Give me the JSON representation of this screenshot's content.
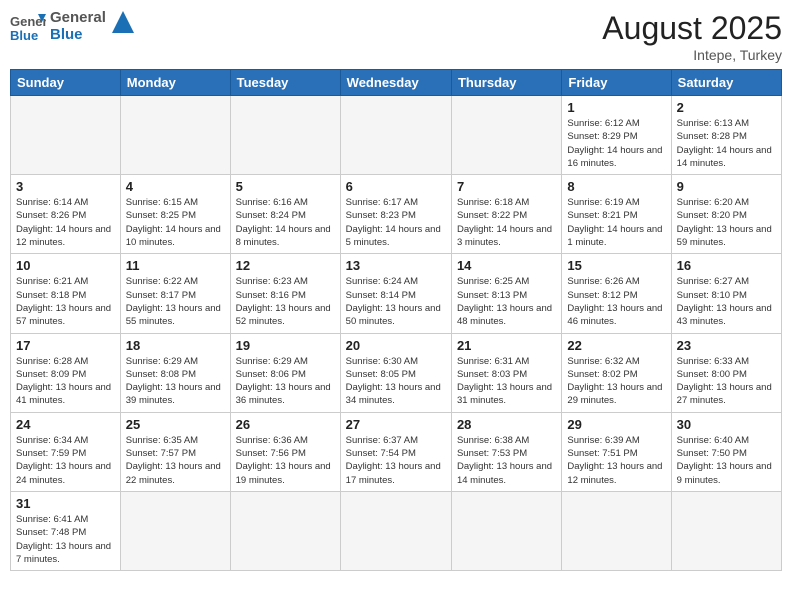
{
  "header": {
    "logo_general": "General",
    "logo_blue": "Blue",
    "month_year": "August 2025",
    "location": "Intepe, Turkey"
  },
  "days_of_week": [
    "Sunday",
    "Monday",
    "Tuesday",
    "Wednesday",
    "Thursday",
    "Friday",
    "Saturday"
  ],
  "weeks": [
    [
      {
        "day": "",
        "info": ""
      },
      {
        "day": "",
        "info": ""
      },
      {
        "day": "",
        "info": ""
      },
      {
        "day": "",
        "info": ""
      },
      {
        "day": "",
        "info": ""
      },
      {
        "day": "1",
        "info": "Sunrise: 6:12 AM\nSunset: 8:29 PM\nDaylight: 14 hours and 16 minutes."
      },
      {
        "day": "2",
        "info": "Sunrise: 6:13 AM\nSunset: 8:28 PM\nDaylight: 14 hours and 14 minutes."
      }
    ],
    [
      {
        "day": "3",
        "info": "Sunrise: 6:14 AM\nSunset: 8:26 PM\nDaylight: 14 hours and 12 minutes."
      },
      {
        "day": "4",
        "info": "Sunrise: 6:15 AM\nSunset: 8:25 PM\nDaylight: 14 hours and 10 minutes."
      },
      {
        "day": "5",
        "info": "Sunrise: 6:16 AM\nSunset: 8:24 PM\nDaylight: 14 hours and 8 minutes."
      },
      {
        "day": "6",
        "info": "Sunrise: 6:17 AM\nSunset: 8:23 PM\nDaylight: 14 hours and 5 minutes."
      },
      {
        "day": "7",
        "info": "Sunrise: 6:18 AM\nSunset: 8:22 PM\nDaylight: 14 hours and 3 minutes."
      },
      {
        "day": "8",
        "info": "Sunrise: 6:19 AM\nSunset: 8:21 PM\nDaylight: 14 hours and 1 minute."
      },
      {
        "day": "9",
        "info": "Sunrise: 6:20 AM\nSunset: 8:20 PM\nDaylight: 13 hours and 59 minutes."
      }
    ],
    [
      {
        "day": "10",
        "info": "Sunrise: 6:21 AM\nSunset: 8:18 PM\nDaylight: 13 hours and 57 minutes."
      },
      {
        "day": "11",
        "info": "Sunrise: 6:22 AM\nSunset: 8:17 PM\nDaylight: 13 hours and 55 minutes."
      },
      {
        "day": "12",
        "info": "Sunrise: 6:23 AM\nSunset: 8:16 PM\nDaylight: 13 hours and 52 minutes."
      },
      {
        "day": "13",
        "info": "Sunrise: 6:24 AM\nSunset: 8:14 PM\nDaylight: 13 hours and 50 minutes."
      },
      {
        "day": "14",
        "info": "Sunrise: 6:25 AM\nSunset: 8:13 PM\nDaylight: 13 hours and 48 minutes."
      },
      {
        "day": "15",
        "info": "Sunrise: 6:26 AM\nSunset: 8:12 PM\nDaylight: 13 hours and 46 minutes."
      },
      {
        "day": "16",
        "info": "Sunrise: 6:27 AM\nSunset: 8:10 PM\nDaylight: 13 hours and 43 minutes."
      }
    ],
    [
      {
        "day": "17",
        "info": "Sunrise: 6:28 AM\nSunset: 8:09 PM\nDaylight: 13 hours and 41 minutes."
      },
      {
        "day": "18",
        "info": "Sunrise: 6:29 AM\nSunset: 8:08 PM\nDaylight: 13 hours and 39 minutes."
      },
      {
        "day": "19",
        "info": "Sunrise: 6:29 AM\nSunset: 8:06 PM\nDaylight: 13 hours and 36 minutes."
      },
      {
        "day": "20",
        "info": "Sunrise: 6:30 AM\nSunset: 8:05 PM\nDaylight: 13 hours and 34 minutes."
      },
      {
        "day": "21",
        "info": "Sunrise: 6:31 AM\nSunset: 8:03 PM\nDaylight: 13 hours and 31 minutes."
      },
      {
        "day": "22",
        "info": "Sunrise: 6:32 AM\nSunset: 8:02 PM\nDaylight: 13 hours and 29 minutes."
      },
      {
        "day": "23",
        "info": "Sunrise: 6:33 AM\nSunset: 8:00 PM\nDaylight: 13 hours and 27 minutes."
      }
    ],
    [
      {
        "day": "24",
        "info": "Sunrise: 6:34 AM\nSunset: 7:59 PM\nDaylight: 13 hours and 24 minutes."
      },
      {
        "day": "25",
        "info": "Sunrise: 6:35 AM\nSunset: 7:57 PM\nDaylight: 13 hours and 22 minutes."
      },
      {
        "day": "26",
        "info": "Sunrise: 6:36 AM\nSunset: 7:56 PM\nDaylight: 13 hours and 19 minutes."
      },
      {
        "day": "27",
        "info": "Sunrise: 6:37 AM\nSunset: 7:54 PM\nDaylight: 13 hours and 17 minutes."
      },
      {
        "day": "28",
        "info": "Sunrise: 6:38 AM\nSunset: 7:53 PM\nDaylight: 13 hours and 14 minutes."
      },
      {
        "day": "29",
        "info": "Sunrise: 6:39 AM\nSunset: 7:51 PM\nDaylight: 13 hours and 12 minutes."
      },
      {
        "day": "30",
        "info": "Sunrise: 6:40 AM\nSunset: 7:50 PM\nDaylight: 13 hours and 9 minutes."
      }
    ],
    [
      {
        "day": "31",
        "info": "Sunrise: 6:41 AM\nSunset: 7:48 PM\nDaylight: 13 hours and 7 minutes."
      },
      {
        "day": "",
        "info": ""
      },
      {
        "day": "",
        "info": ""
      },
      {
        "day": "",
        "info": ""
      },
      {
        "day": "",
        "info": ""
      },
      {
        "day": "",
        "info": ""
      },
      {
        "day": "",
        "info": ""
      }
    ]
  ]
}
